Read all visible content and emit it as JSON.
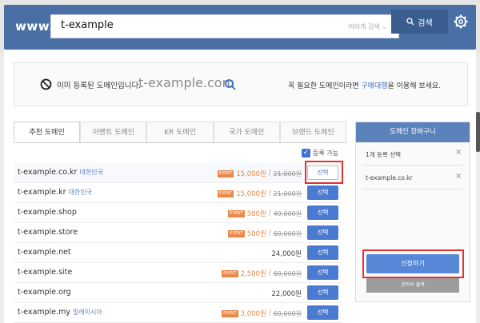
{
  "header": {
    "brand": "www.",
    "search_value": "t-example",
    "scope_label": "여러개 검색",
    "search_button": "검색"
  },
  "notice": {
    "registered_text": "이미 등록된 도메인입니다.",
    "domain": "t-example.com",
    "right_text_pre": "꼭 필요한 도메인이라면 ",
    "right_link": "구매대행",
    "right_text_post": "을 이용해 보세요."
  },
  "tabs": [
    "추천 도메인",
    "이벤트 도메인",
    "KR 도메인",
    "국가 도메인",
    "브랜드 도메인"
  ],
  "availability_label": "등록 가능",
  "domains": [
    {
      "name": "t-example.co.kr",
      "country": "대한민국",
      "event": "EVENT",
      "sale": "15,000원",
      "orig": "21,000원",
      "button": "선택"
    },
    {
      "name": "t-example.kr",
      "country": "대한민국",
      "event": "EVENT",
      "sale": "15,000원",
      "orig": "21,000원",
      "button": "선택"
    },
    {
      "name": "t-example.shop",
      "country": "",
      "event": "EVENT",
      "sale": "500원",
      "orig": "49,000원",
      "button": "선택"
    },
    {
      "name": "t-example.store",
      "country": "",
      "event": "EVENT",
      "sale": "500원",
      "orig": "60,000원",
      "button": "선택"
    },
    {
      "name": "t-example.net",
      "country": "",
      "event": "",
      "price": "24,000원",
      "button": "선택"
    },
    {
      "name": "t-example.site",
      "country": "",
      "event": "EVENT",
      "sale": "2,500원",
      "orig": "60,000원",
      "button": "선택"
    },
    {
      "name": "t-example.org",
      "country": "",
      "event": "",
      "price": "22,000원",
      "button": "선택"
    },
    {
      "name": "t-example.my",
      "country": "말레이시아",
      "event": "EVENT",
      "sale": "3,000원",
      "orig": "60,000원",
      "button": "선택"
    }
  ],
  "cart": {
    "title": "도메인 장바구니",
    "count_text": "1개 등록 선택",
    "item": "t-example.co.kr",
    "remove": "×",
    "apply_button": "신청하기",
    "estimate_button": "견적서 출력"
  },
  "colors": {
    "header": "#4a6fa5",
    "button": "#4a7bd0",
    "event": "#e8894a",
    "highlight": "#e53030"
  }
}
